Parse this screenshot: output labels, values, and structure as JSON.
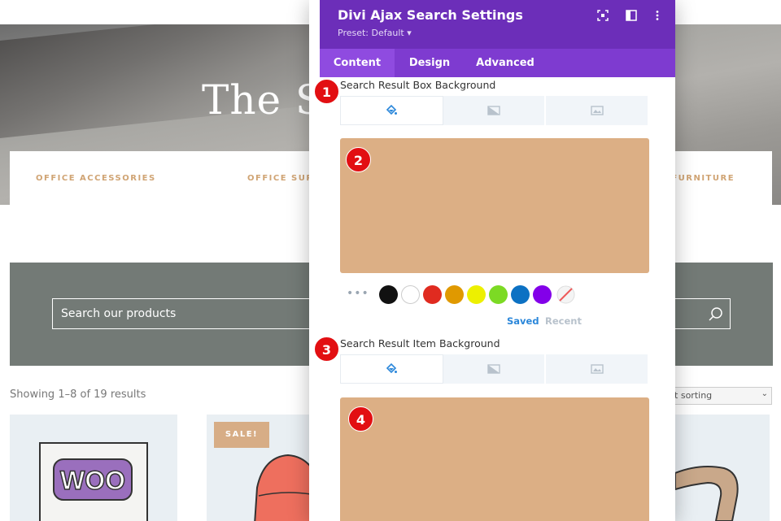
{
  "storefront": {
    "hero_title": "The Sh",
    "categories": [
      "OFFICE ACCESSORIES",
      "OFFICE SUPPLI",
      "E FURNITURE"
    ],
    "search_placeholder": "Search our products",
    "results_count": "Showing 1–8 of 19 results",
    "sort_label": "ult sorting",
    "sale_badge": "SALE!"
  },
  "modal": {
    "title": "Divi Ajax Search Settings",
    "preset": "Preset: Default ▾",
    "tabs": [
      {
        "label": "Content",
        "active": true
      },
      {
        "label": "Design",
        "active": false
      },
      {
        "label": "Advanced",
        "active": false
      }
    ],
    "section1_label": "Search Result Box Background",
    "section2_label": "Search Result Item Background",
    "background_color": "#dcaf85",
    "palette": [
      "#111111",
      "#ffffff",
      "#e02b20",
      "#e09900",
      "#edf000",
      "#7cda24",
      "#0c71c3",
      "#8300e9"
    ],
    "palette_tabs": {
      "saved": "Saved",
      "recent": "Recent"
    },
    "more_dots": "•••"
  },
  "markers": [
    "1",
    "2",
    "3",
    "4"
  ],
  "colors": {
    "header": "#6c2eb9",
    "tabs": "#7e3bd0",
    "accent_link": "#2b87da",
    "category_text": "#d0a474"
  }
}
